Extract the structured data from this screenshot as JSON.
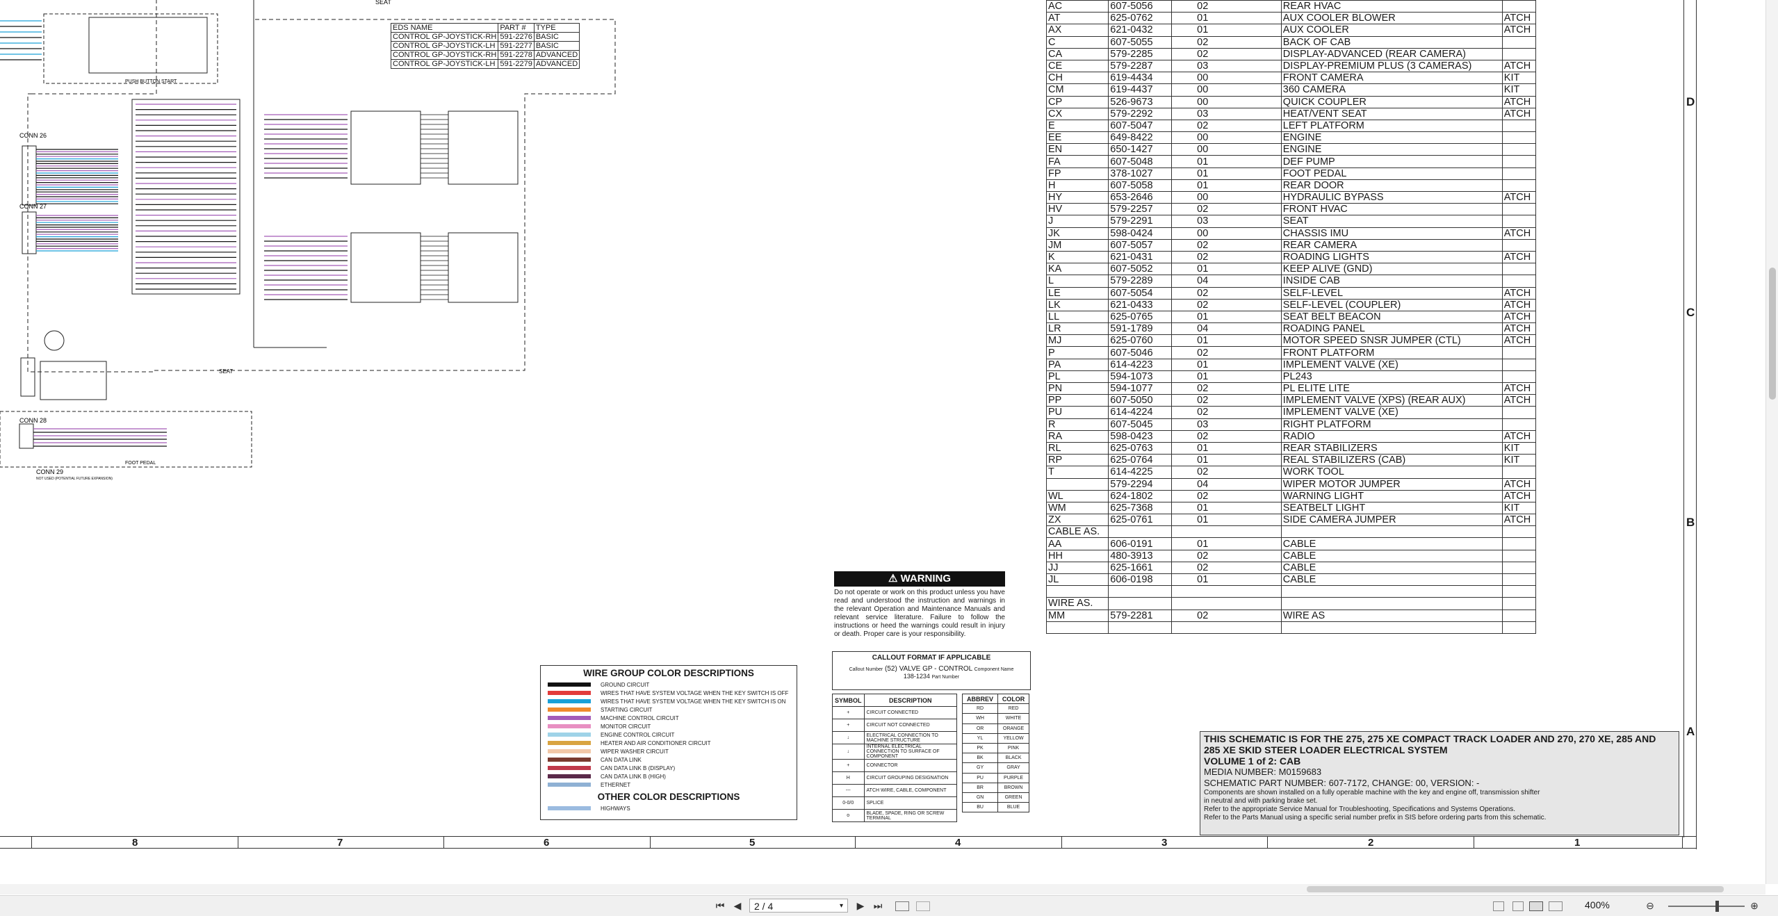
{
  "connectors": {
    "rows": [
      [
        "AC",
        "607-5056",
        "02",
        "REAR HVAC",
        ""
      ],
      [
        "AT",
        "625-0762",
        "01",
        "AUX COOLER BLOWER",
        "ATCH"
      ],
      [
        "AX",
        "621-0432",
        "01",
        "AUX COOLER",
        "ATCH"
      ],
      [
        "C",
        "607-5055",
        "02",
        "BACK OF CAB",
        ""
      ],
      [
        "CA",
        "579-2285",
        "02",
        "DISPLAY-ADVANCED (REAR CAMERA)",
        ""
      ],
      [
        "CE",
        "579-2287",
        "03",
        "DISPLAY-PREMIUM PLUS  (3 CAMERAS)",
        "ATCH"
      ],
      [
        "CH",
        "619-4434",
        "00",
        "FRONT CAMERA",
        "KIT"
      ],
      [
        "CM",
        "619-4437",
        "00",
        "360 CAMERA",
        "KIT"
      ],
      [
        "CP",
        "526-9673",
        "00",
        "QUICK COUPLER",
        "ATCH"
      ],
      [
        "CX",
        "579-2292",
        "03",
        "HEAT/VENT SEAT",
        "ATCH"
      ],
      [
        "E",
        "607-5047",
        "02",
        "LEFT PLATFORM",
        ""
      ],
      [
        "EE",
        "649-8422",
        "00",
        "ENGINE",
        ""
      ],
      [
        "EN",
        "650-1427",
        "00",
        "ENGINE",
        ""
      ],
      [
        "FA",
        "607-5048",
        "01",
        "DEF PUMP",
        ""
      ],
      [
        "FP",
        "378-1027",
        "01",
        "FOOT PEDAL",
        ""
      ],
      [
        "H",
        "607-5058",
        "01",
        "REAR DOOR",
        ""
      ],
      [
        "HY",
        "653-2646",
        "00",
        "HYDRAULIC BYPASS",
        "ATCH"
      ],
      [
        "HV",
        "579-2257",
        "02",
        "FRONT HVAC",
        ""
      ],
      [
        "J",
        "579-2291",
        "03",
        "SEAT",
        ""
      ],
      [
        "JK",
        "598-0424",
        "00",
        "CHASSIS IMU",
        "ATCH"
      ],
      [
        "JM",
        "607-5057",
        "02",
        "REAR CAMERA",
        ""
      ],
      [
        "K",
        "621-0431",
        "02",
        "ROADING LIGHTS",
        "ATCH"
      ],
      [
        "KA",
        "607-5052",
        "01",
        "KEEP ALIVE (GND)",
        ""
      ],
      [
        "L",
        "579-2289",
        "04",
        "INSIDE CAB",
        ""
      ],
      [
        "LE",
        "607-5054",
        "02",
        "SELF-LEVEL",
        "ATCH"
      ],
      [
        "LK",
        "621-0433",
        "02",
        "SELF-LEVEL (COUPLER)",
        "ATCH"
      ],
      [
        "LL",
        "625-0765",
        "01",
        "SEAT BELT BEACON",
        "ATCH"
      ],
      [
        "LR",
        "591-1789",
        "04",
        "ROADING PANEL",
        "ATCH"
      ],
      [
        "MJ",
        "625-0760",
        "01",
        "MOTOR SPEED SNSR JUMPER (CTL)",
        "ATCH"
      ],
      [
        "P",
        "607-5046",
        "02",
        "FRONT PLATFORM",
        ""
      ],
      [
        "PA",
        "614-4223",
        "01",
        "IMPLEMENT VALVE (XE)",
        ""
      ],
      [
        "PL",
        "594-1073",
        "01",
        "PL243",
        ""
      ],
      [
        "PN",
        "594-1077",
        "02",
        "PL ELITE LITE",
        "ATCH"
      ],
      [
        "PP",
        "607-5050",
        "02",
        "IMPLEMENT VALVE (XPS) (REAR AUX)",
        "ATCH"
      ],
      [
        "PU",
        "614-4224",
        "02",
        "IMPLEMENT VALVE (XE)",
        ""
      ],
      [
        "R",
        "607-5045",
        "03",
        "RIGHT PLATFORM",
        ""
      ],
      [
        "RA",
        "598-0423",
        "02",
        "RADIO",
        "ATCH"
      ],
      [
        "RL",
        "625-0763",
        "01",
        "REAR STABILIZERS",
        "KIT"
      ],
      [
        "RP",
        "625-0764",
        "01",
        "REAL STABILIZERS (CAB)",
        "KIT"
      ],
      [
        "T",
        "614-4225",
        "02",
        "WORK TOOL",
        ""
      ],
      [
        "",
        "579-2294",
        "04",
        "WIPER MOTOR JUMPER",
        "ATCH"
      ],
      [
        "WL",
        "624-1802",
        "02",
        "WARNING LIGHT",
        "ATCH"
      ],
      [
        "WM",
        "625-7368",
        "01",
        "SEATBELT LIGHT",
        "KIT"
      ],
      [
        "ZX",
        "625-0761",
        "01",
        "SIDE CAMERA JUMPER",
        "ATCH"
      ],
      [
        "CABLE AS.",
        "",
        "",
        "",
        ""
      ],
      [
        "AA",
        "606-0191",
        "01",
        "CABLE",
        ""
      ],
      [
        "HH",
        "480-3913",
        "02",
        "CABLE",
        ""
      ],
      [
        "JJ",
        "625-1661",
        "02",
        "CABLE",
        ""
      ],
      [
        "JL",
        "606-0198",
        "01",
        "CABLE",
        ""
      ],
      [
        "",
        "",
        "",
        "",
        ""
      ],
      [
        "WIRE AS.",
        "",
        "",
        "",
        ""
      ],
      [
        "MM",
        "579-2281",
        "02",
        "WIRE AS",
        ""
      ],
      [
        "",
        "",
        "",
        "",
        ""
      ]
    ]
  },
  "eds": {
    "header": [
      "EDS NAME",
      "PART #",
      "TYPE"
    ],
    "rows": [
      [
        "CONTROL GP-JOYSTICK-RH",
        "591-2276",
        "BASIC"
      ],
      [
        "CONTROL GP-JOYSTICK-LH",
        "591-2277",
        "BASIC"
      ],
      [
        "CONTROL GP-JOYSTICK-RH",
        "591-2278",
        "ADVANCED"
      ],
      [
        "CONTROL GP-JOYSTICK-LH",
        "591-2279",
        "ADVANCED"
      ]
    ]
  },
  "diagram_labels": {
    "conn26": "CONN 26",
    "conn27": "CONN 27",
    "conn28": "CONN 28",
    "conn29": "CONN 29",
    "seat_top": "SEAT",
    "seat_bottom": "SEAT",
    "push_button_start": "PUSH BUTTON START",
    "foot_pedal": "FOOT PEDAL",
    "conn29_note": "NOT USED (POTENTIAL FUTURE EXPANSION)"
  },
  "zones": {
    "right": [
      "D",
      "C",
      "B",
      "A"
    ],
    "bottom": [
      "8",
      "7",
      "6",
      "5",
      "4",
      "3",
      "2",
      "1"
    ]
  },
  "warning": {
    "title": "WARNING",
    "text": "Do not operate or work on this product unless you have read and understood the instruction and warnings in the relevant Operation and Maintenance Manuals and relevant service literature. Failure to follow the instructions or heed the warnings could result in injury or death. Proper care is your responsibility."
  },
  "wire_colors": {
    "title": "WIRE GROUP COLOR DESCRIPTIONS",
    "items": [
      {
        "color": "#111111",
        "label": "GROUND CIRCUIT"
      },
      {
        "color": "#e23b3b",
        "label": "WIRES THAT HAVE SYSTEM VOLTAGE WHEN THE KEY SWITCH IS OFF"
      },
      {
        "color": "#1aa0d8",
        "label": "WIRES THAT HAVE SYSTEM VOLTAGE WHEN THE KEY SWITCH IS ON"
      },
      {
        "color": "#f08a2c",
        "label": "STARTING CIRCUIT"
      },
      {
        "color": "#a35bb8",
        "label": "MACHINE CONTROL CIRCUIT"
      },
      {
        "color": "#e88fc2",
        "label": "MONITOR CIRCUIT"
      },
      {
        "color": "#9fd3e8",
        "label": "ENGINE CONTROL CIRCUIT"
      },
      {
        "color": "#d9a441",
        "label": "HEATER AND AIR CONDITIONER CIRCUIT"
      },
      {
        "color": "#f2c8a8",
        "label": "WIPER WASHER CIRCUIT"
      },
      {
        "color": "#7a3a2f",
        "label": "CAN DATA LINK"
      },
      {
        "color": "#c0394b",
        "label": "CAN DATA LINK B (DISPLAY)"
      },
      {
        "color": "#5b2a4a",
        "label": "CAN DATA LINK B (HIGH)"
      },
      {
        "color": "#8fb1d4",
        "label": "ETHERNET"
      }
    ],
    "other_title": "OTHER COLOR DESCRIPTIONS",
    "other_items": [
      {
        "color": "#9bbbe0",
        "label": "HIGHWAYS"
      }
    ]
  },
  "callout": {
    "title": "CALLOUT FORMAT IF APPLICABLE",
    "left_note": "Callout Number",
    "example": "(52) VALVE GP - CONTROL",
    "part": "138-1234",
    "part_note": "Part Number",
    "name_note": "Component Name"
  },
  "symbols": {
    "header": [
      "SYMBOL",
      "DESCRIPTION"
    ],
    "rows": [
      [
        "+",
        "CIRCUIT CONNECTED"
      ],
      [
        "+",
        "CIRCUIT NOT CONNECTED"
      ],
      [
        "↓",
        "ELECTRICAL CONNECTION TO MACHINE STRUCTURE"
      ],
      [
        "↓",
        "INTERNAL ELECTRICAL CONNECTION TO SURFACE OF COMPONENT"
      ],
      [
        "+",
        "CONNECTOR"
      ],
      [
        "H",
        "CIRCUIT GROUPING DESIGNATION"
      ],
      [
        "---",
        "ATCH WIRE, CABLE, COMPONENT"
      ],
      [
        "0-0/0",
        "SPLICE"
      ],
      [
        "o",
        "BLADE, SPADE, RING OR SCREW TERMINAL"
      ]
    ]
  },
  "abbrev": {
    "header": [
      "ABBREV",
      "COLOR"
    ],
    "rows": [
      [
        "RD",
        "RED"
      ],
      [
        "WH",
        "WHITE"
      ],
      [
        "OR",
        "ORANGE"
      ],
      [
        "YL",
        "YELLOW"
      ],
      [
        "PK",
        "PINK"
      ],
      [
        "BK",
        "BLACK"
      ],
      [
        "GY",
        "GRAY"
      ],
      [
        "PU",
        "PURPLE"
      ],
      [
        "BR",
        "BROWN"
      ],
      [
        "GN",
        "GREEN"
      ],
      [
        "BU",
        "BLUE"
      ]
    ]
  },
  "title_block": {
    "line1": "THIS SCHEMATIC IS FOR THE 275, 275 XE COMPACT TRACK LOADER AND 270, 270 XE, 285 AND",
    "line2": "285 XE SKID STEER LOADER ELECTRICAL SYSTEM",
    "line3": "VOLUME 1 of 2: CAB",
    "line4": "MEDIA NUMBER: M0159683",
    "line5": "SCHEMATIC PART NUMBER: 607-7172, CHANGE: 00, VERSION: -",
    "line6": "Components are shown installed on a fully operable machine with the key and engine off, transmission shifter",
    "line7": "in neutral and with parking brake set.",
    "line8": "Refer to the appropriate Service Manual for Troubleshooting, Specifications and Systems Operations.",
    "line9": "Refer to the Parts Manual using a specific serial number prefix in SIS before ordering parts from this schematic."
  },
  "toolbar": {
    "page": "2 / 4",
    "zoom": "400%",
    "first_label": "⏮",
    "prev_label": "◀",
    "next_label": "▶",
    "last_label": "⏭",
    "dropdown": "▾",
    "zoom_out": "⊖",
    "zoom_in": "⊕"
  }
}
